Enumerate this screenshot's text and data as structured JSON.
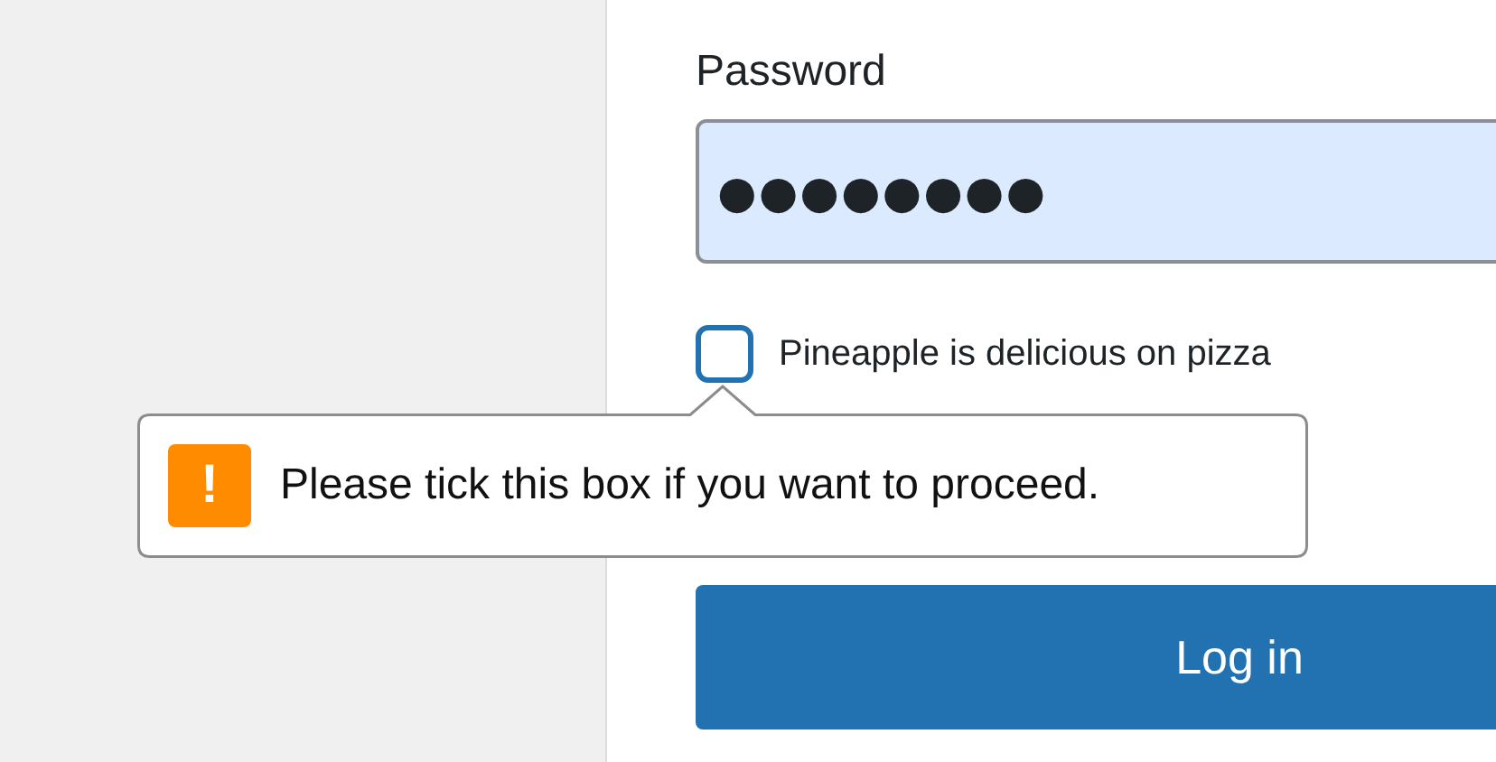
{
  "password_field": {
    "label": "Password",
    "value": "●●●●●●●●"
  },
  "checkbox": {
    "label": "Pineapple is delicious on pizza",
    "checked": false
  },
  "validation_tooltip": {
    "icon": "!",
    "message": "Please tick this box if you want to proceed."
  },
  "submit_button": {
    "label": "Log in"
  }
}
